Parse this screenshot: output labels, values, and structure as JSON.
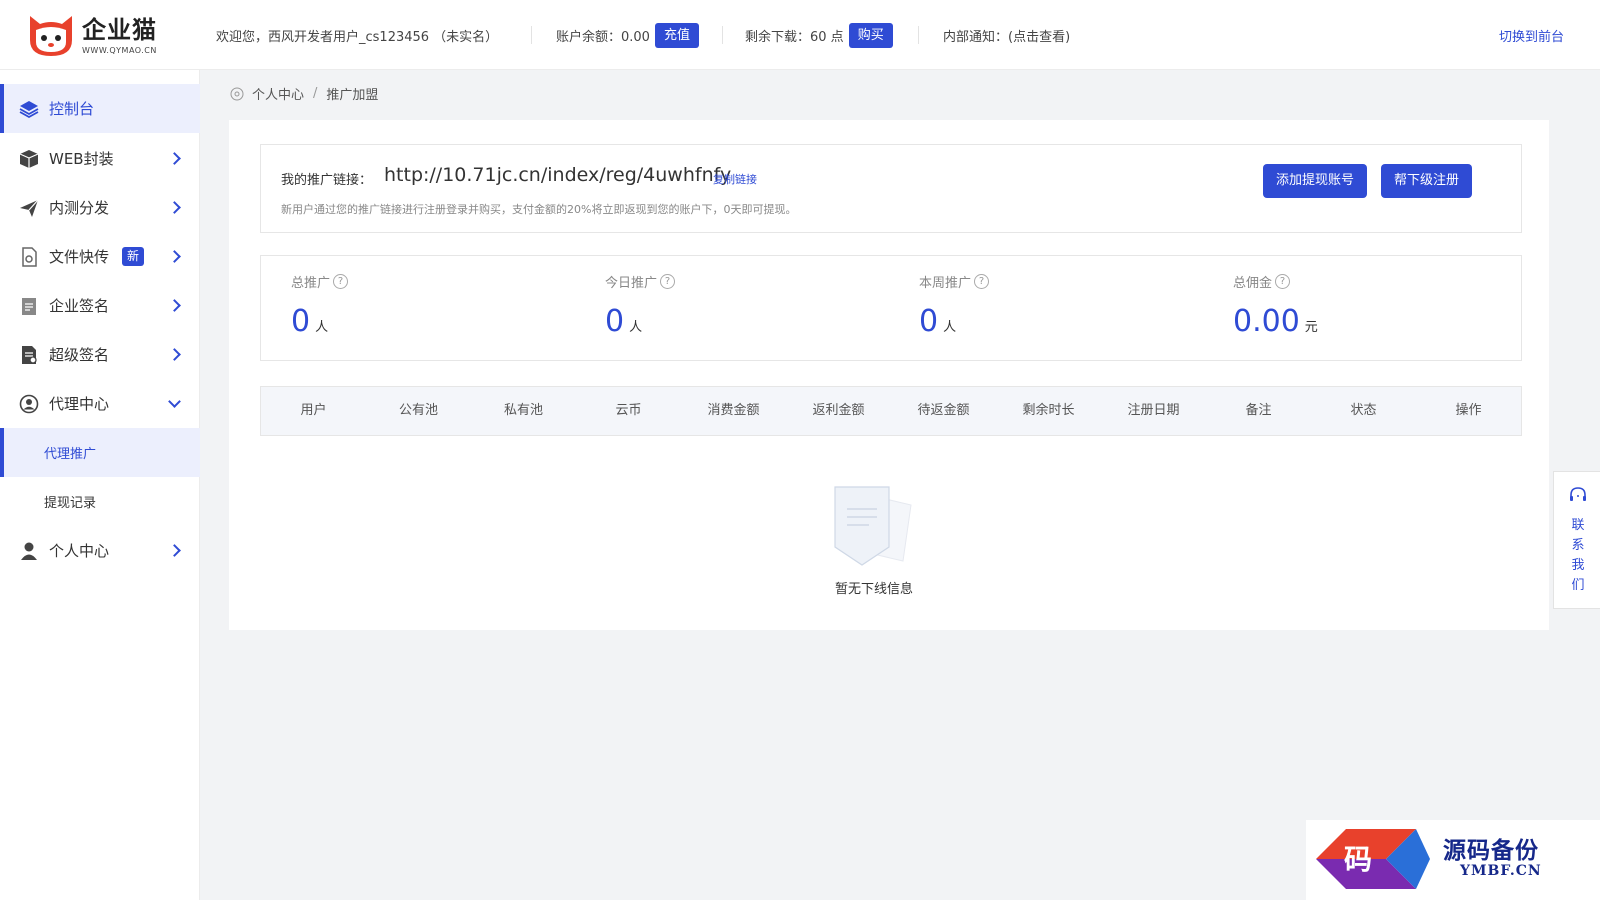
{
  "header": {
    "logo_title": "企业猫",
    "logo_sub": "WWW.QYMAO.CN",
    "welcome": "欢迎您，西风开发者用户_cs123456 （未实名）",
    "balance_label": "账户余额：0.00",
    "recharge_label": "充值",
    "downloads_label": "剩余下载：60 点",
    "buy_label": "购买",
    "notice": "内部通知：(点击查看)",
    "switch_label": "切换到前台"
  },
  "sidebar": {
    "items": [
      {
        "label": "控制台",
        "icon": "layers-icon"
      },
      {
        "label": "WEB封装",
        "icon": "box-icon"
      },
      {
        "label": "内测分发",
        "icon": "send-icon"
      },
      {
        "label": "文件快传",
        "icon": "file-icon",
        "badge": "新"
      },
      {
        "label": "企业签名",
        "icon": "clipboard-icon"
      },
      {
        "label": "超级签名",
        "icon": "document-icon"
      },
      {
        "label": "代理中心",
        "icon": "agent-icon"
      },
      {
        "label": "个人中心",
        "icon": "user-icon"
      }
    ],
    "sub_items": [
      {
        "label": "代理推广"
      },
      {
        "label": "提现记录"
      }
    ]
  },
  "breadcrumb": {
    "parent": "个人中心",
    "separator": "/",
    "current": "推广加盟"
  },
  "promo": {
    "label": "我的推广链接：",
    "link": "http://10.71jc.cn/index/reg/4uwhfnfy",
    "copy_label": "复制链接",
    "description": "新用户通过您的推广链接进行注册登录并购买，支付金额的20%将立即返现到您的账户下，0天即可提现。",
    "add_account_label": "添加提现账号",
    "register_label": "帮下级注册"
  },
  "stats": [
    {
      "label": "总推广",
      "value": "0",
      "unit": "人"
    },
    {
      "label": "今日推广",
      "value": "0",
      "unit": "人"
    },
    {
      "label": "本周推广",
      "value": "0",
      "unit": "人"
    },
    {
      "label": "总佣金",
      "value": "0.00",
      "unit": "元"
    }
  ],
  "table": {
    "columns": [
      "用户",
      "公有池",
      "私有池",
      "云币",
      "消费金额",
      "返利金额",
      "待返金额",
      "剩余时长",
      "注册日期",
      "备注",
      "状态",
      "操作"
    ],
    "rows": [],
    "empty_text": "暂无下线信息"
  },
  "contact": {
    "label": "联系我们"
  },
  "watermark": {
    "title": "源码备份",
    "domain": "YMBF.CN",
    "glyph": "码"
  },
  "colors": {
    "primary": "#2f4bd4",
    "active_bg": "#eceffd",
    "logo_red": "#e8412c"
  }
}
